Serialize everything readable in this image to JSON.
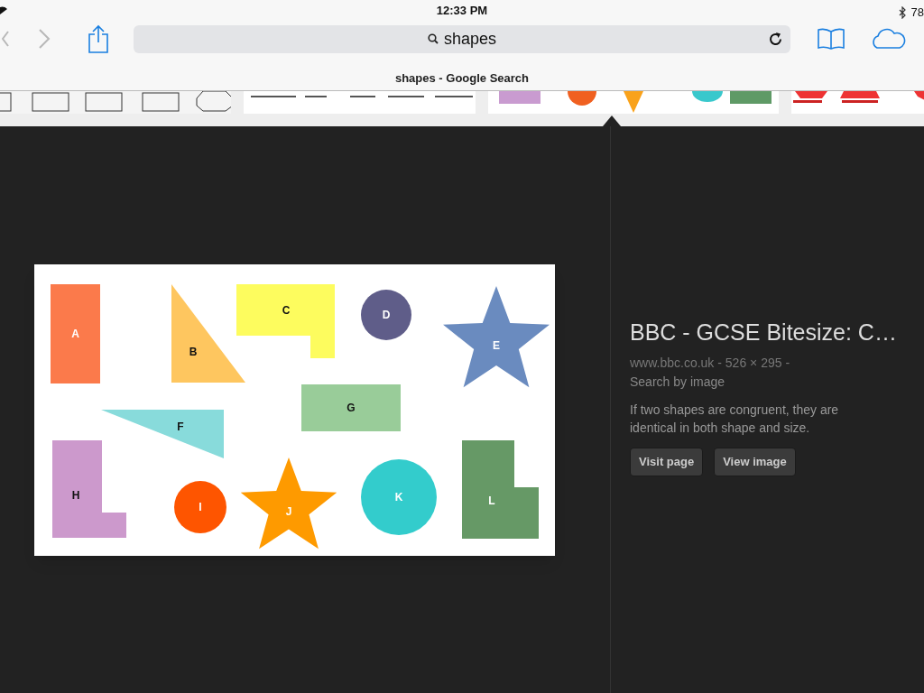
{
  "status_bar": {
    "time": "12:33 PM",
    "battery": "78"
  },
  "toolbar": {
    "back_disabled": true,
    "forward_disabled": true,
    "address": "shapes"
  },
  "page_title": "shapes - Google Search",
  "preview": {
    "shapes": [
      {
        "label": "A",
        "color": "#fb7a4b",
        "kind": "rect"
      },
      {
        "label": "B",
        "color": "#fec65f",
        "kind": "triangle"
      },
      {
        "label": "C",
        "color": "#fdfc5e",
        "kind": "lshape"
      },
      {
        "label": "D",
        "color": "#5f5d89",
        "kind": "circle"
      },
      {
        "label": "E",
        "color": "#6a8bbf",
        "kind": "star"
      },
      {
        "label": "F",
        "color": "#88dbdb",
        "kind": "triangle"
      },
      {
        "label": "G",
        "color": "#99cc99",
        "kind": "rect"
      },
      {
        "label": "H",
        "color": "#cc99cc",
        "kind": "lshape"
      },
      {
        "label": "I",
        "color": "#fe5500",
        "kind": "circle"
      },
      {
        "label": "J",
        "color": "#fe9a00",
        "kind": "star"
      },
      {
        "label": "K",
        "color": "#33cccc",
        "kind": "circle"
      },
      {
        "label": "L",
        "color": "#669966",
        "kind": "lshape"
      }
    ]
  },
  "details": {
    "title": "BBC - GCSE Bitesize: C…",
    "meta": "www.bbc.co.uk - 526 × 295 -",
    "search_link": "Search by image",
    "description": "If two shapes are congruent, they are identical in both shape and size.",
    "buttons": [
      "Visit page",
      "View image"
    ]
  }
}
